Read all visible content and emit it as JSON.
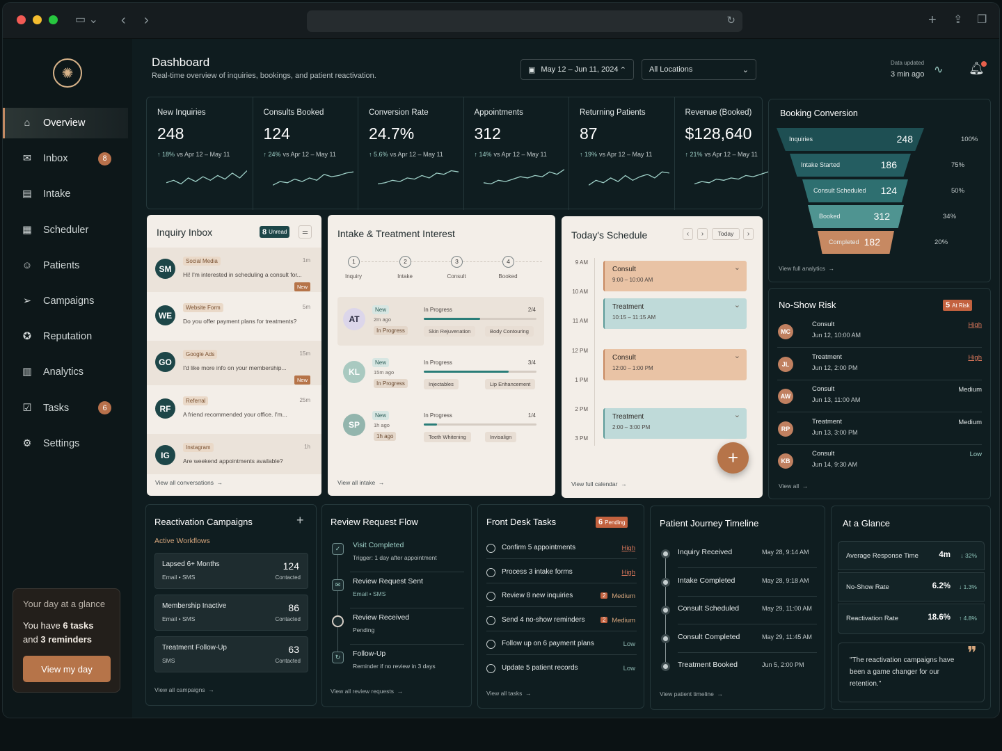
{
  "sidebar": {
    "items": [
      {
        "label": "Overview",
        "icon": "home-icon"
      },
      {
        "label": "Inbox",
        "icon": "inbox-icon",
        "badge": "8"
      },
      {
        "label": "Intake",
        "icon": "clipboard-icon"
      },
      {
        "label": "Scheduler",
        "icon": "calendar-icon"
      },
      {
        "label": "Patients",
        "icon": "users-icon"
      },
      {
        "label": "Campaigns",
        "icon": "megaphone-icon"
      },
      {
        "label": "Reputation",
        "icon": "star-icon"
      },
      {
        "label": "Analytics",
        "icon": "bar-chart-icon"
      },
      {
        "label": "Tasks",
        "icon": "checkbox-icon",
        "badge": "6"
      },
      {
        "label": "Settings",
        "icon": "gear-icon"
      }
    ],
    "glance_title": "Your day at a glance",
    "glance_text_1": "You have ",
    "glance_tasks": "6 tasks",
    "glance_text_2": "and ",
    "glance_reminders": "3 reminders",
    "glance_button": "View my day"
  },
  "header": {
    "title": "Dashboard",
    "subtitle": "Real-time overview of inquiries, bookings, and patient reactivation.",
    "date_range": "May 12 – Jun 11, 2024",
    "location": "All Locations",
    "updated_label": "Data updated",
    "updated_value": "3 min ago"
  },
  "kpis": [
    {
      "label": "New Inquiries",
      "value": "248",
      "delta": "18%",
      "compare": "vs Apr 12 – May 11"
    },
    {
      "label": "Consults Booked",
      "value": "124",
      "delta": "24%",
      "compare": "vs Apr 12 – May 11"
    },
    {
      "label": "Conversion Rate",
      "value": "24.7%",
      "delta": "5.6%",
      "compare": "vs Apr 12 – May 11"
    },
    {
      "label": "Appointments",
      "value": "312",
      "delta": "14%",
      "compare": "vs Apr 12 – May 11"
    },
    {
      "label": "Returning Patients",
      "value": "87",
      "delta": "19%",
      "compare": "vs Apr 12 – May 11"
    },
    {
      "label": "Revenue (Booked)",
      "value": "$128,640",
      "delta": "21%",
      "compare": "vs Apr 12 – May 11"
    }
  ],
  "funnel": {
    "title": "Booking Conversion",
    "stages": [
      {
        "label": "Inquiries",
        "value": "248",
        "pct": "100%"
      },
      {
        "label": "Intake Started",
        "value": "186",
        "pct": "75%"
      },
      {
        "label": "Consult Scheduled",
        "value": "124",
        "pct": "50%"
      },
      {
        "label": "Booked",
        "value": "312",
        "pct": "34%"
      },
      {
        "label": "Completed",
        "value": "182",
        "pct": "20%"
      }
    ],
    "link": "View full analytics"
  },
  "inbox": {
    "title": "Inquiry Inbox",
    "unread_count": "8",
    "unread_label": "Unread",
    "items": [
      {
        "initials": "SM",
        "source": "Social Media",
        "time": "1m",
        "text": "Hi! I'm interested in scheduling a consult for...",
        "new": "New"
      },
      {
        "initials": "WE",
        "source": "Website Form",
        "time": "5m",
        "text": "Do you offer payment plans for treatments?",
        "new": ""
      },
      {
        "initials": "GO",
        "source": "Google Ads",
        "time": "15m",
        "text": "I'd like more info on your membership...",
        "new": "New"
      },
      {
        "initials": "RF",
        "source": "Referral",
        "time": "25m",
        "text": "A friend recommended your office. I'm...",
        "new": ""
      },
      {
        "initials": "IG",
        "source": "Instagram",
        "time": "1h",
        "text": "Are weekend appointments available?",
        "new": ""
      }
    ],
    "link": "View all conversations"
  },
  "intake": {
    "title": "Intake & Treatment Interest",
    "steps": [
      {
        "n": "1",
        "label": "Inquiry"
      },
      {
        "n": "2",
        "label": "Intake"
      },
      {
        "n": "3",
        "label": "Consult"
      },
      {
        "n": "4",
        "label": "Booked"
      }
    ],
    "rows": [
      {
        "initials": "AT",
        "tag": "New",
        "time": "2m ago",
        "state": "In Progress",
        "progress_label": "In Progress",
        "count": "2/4",
        "progress": 0.5,
        "treatments": [
          "Skin Rejuvenation",
          "Body Contouring"
        ]
      },
      {
        "initials": "KL",
        "tag": "New",
        "time": "15m ago",
        "state": "In Progress",
        "progress_label": "In Progress",
        "count": "3/4",
        "progress": 0.75,
        "treatments": [
          "Injectables",
          "Lip Enhancement"
        ]
      },
      {
        "initials": "SP",
        "tag": "New",
        "time": "1h ago",
        "state": "1h ago",
        "progress_label": "In Progress",
        "count": "1/4",
        "progress": 0.12,
        "treatments": [
          "Teeth Whitening",
          "Invisalign"
        ]
      }
    ],
    "link": "View all intake"
  },
  "schedule": {
    "title": "Today's Schedule",
    "today": "Today",
    "times": [
      "9 AM",
      "10 AM",
      "11 AM",
      "12 PM",
      "1 PM",
      "2 PM",
      "3 PM"
    ],
    "events": [
      {
        "type": "Consult",
        "time": "9:00 – 10:00 AM",
        "kind": "consult"
      },
      {
        "type": "Treatment",
        "time": "10:15 – 11:15 AM",
        "kind": "treatment"
      },
      {
        "type": "Consult",
        "time": "12:00 – 1:00 PM",
        "kind": "consult"
      },
      {
        "type": "Treatment",
        "time": "2:00 – 3:00 PM",
        "kind": "treatment"
      }
    ],
    "link": "View full calendar"
  },
  "noshow": {
    "title": "No-Show Risk",
    "badge_count": "5",
    "badge_label": "At Risk",
    "items": [
      {
        "initials": "MC",
        "type": "Consult",
        "when": "Jun 12, 10:00 AM",
        "risk": "High"
      },
      {
        "initials": "JL",
        "type": "Treatment",
        "when": "Jun 12, 2:00 PM",
        "risk": "High"
      },
      {
        "initials": "AW",
        "type": "Consult",
        "when": "Jun 13, 11:00 AM",
        "risk": "Medium"
      },
      {
        "initials": "RP",
        "type": "Treatment",
        "when": "Jun 13, 3:00 PM",
        "risk": "Medium"
      },
      {
        "initials": "KB",
        "type": "Consult",
        "when": "Jun 14, 9:30 AM",
        "risk": "Low"
      }
    ],
    "link": "View all"
  },
  "campaigns": {
    "title": "Reactivation Campaigns",
    "subtitle": "Active Workflows",
    "items": [
      {
        "name": "Lapsed 6+ Months",
        "channels": "Email • SMS",
        "count": "124",
        "count_label": "Contacted"
      },
      {
        "name": "Membership Inactive",
        "channels": "Email • SMS",
        "count": "86",
        "count_label": "Contacted"
      },
      {
        "name": "Treatment Follow-Up",
        "channels": "SMS",
        "count": "63",
        "count_label": "Contacted"
      }
    ],
    "link": "View all campaigns"
  },
  "review": {
    "title": "Review Request Flow",
    "steps": [
      {
        "title": "Visit Completed",
        "sub": "Trigger: 1 day after appointment"
      },
      {
        "title": "Review Request Sent",
        "sub": "Email • SMS"
      },
      {
        "title": "Review Received",
        "sub": "Pending"
      },
      {
        "title": "Follow-Up",
        "sub": "Reminder if no review in 3 days"
      }
    ],
    "link": "View all review requests"
  },
  "tasks": {
    "title": "Front Desk Tasks",
    "badge_count": "6",
    "badge_label": "Pending",
    "items": [
      {
        "text": "Confirm 5 appointments",
        "count": "",
        "priority": "High"
      },
      {
        "text": "Process 3 intake forms",
        "count": "",
        "priority": "High"
      },
      {
        "text": "Review 8 new inquiries",
        "count": "2",
        "priority": "Medium"
      },
      {
        "text": "Send 4 no-show reminders",
        "count": "2",
        "priority": "Medium"
      },
      {
        "text": "Follow up on 6 payment plans",
        "count": "",
        "priority": "Low"
      },
      {
        "text": "Update 5 patient records",
        "count": "",
        "priority": "Low"
      }
    ],
    "link": "View all tasks"
  },
  "journey": {
    "title": "Patient Journey Timeline",
    "items": [
      {
        "label": "Inquiry Received",
        "when": "May 28, 9:14 AM"
      },
      {
        "label": "Intake Completed",
        "when": "May 28, 9:18 AM"
      },
      {
        "label": "Consult Scheduled",
        "when": "May 29, 11:00 AM"
      },
      {
        "label": "Consult Completed",
        "when": "May 29, 11:45 AM"
      },
      {
        "label": "Treatment Booked",
        "when": "Jun 5, 2:00 PM"
      }
    ],
    "link": "View patient timeline"
  },
  "glance": {
    "title": "At a Glance",
    "metrics": [
      {
        "label": "Average Response Time",
        "value": "4m",
        "delta": "↓ 32%"
      },
      {
        "label": "No-Show Rate",
        "value": "6.2%",
        "delta": "↓ 1.3%"
      },
      {
        "label": "Reactivation Rate",
        "value": "18.6%",
        "delta": "↑ 4.8%"
      }
    ],
    "quote": "\"The reactivation campaigns have been a game changer for our retention.\""
  },
  "colors": {
    "accent": "#b67449",
    "teal": "#2a7d78",
    "bg": "#0f1c20"
  }
}
